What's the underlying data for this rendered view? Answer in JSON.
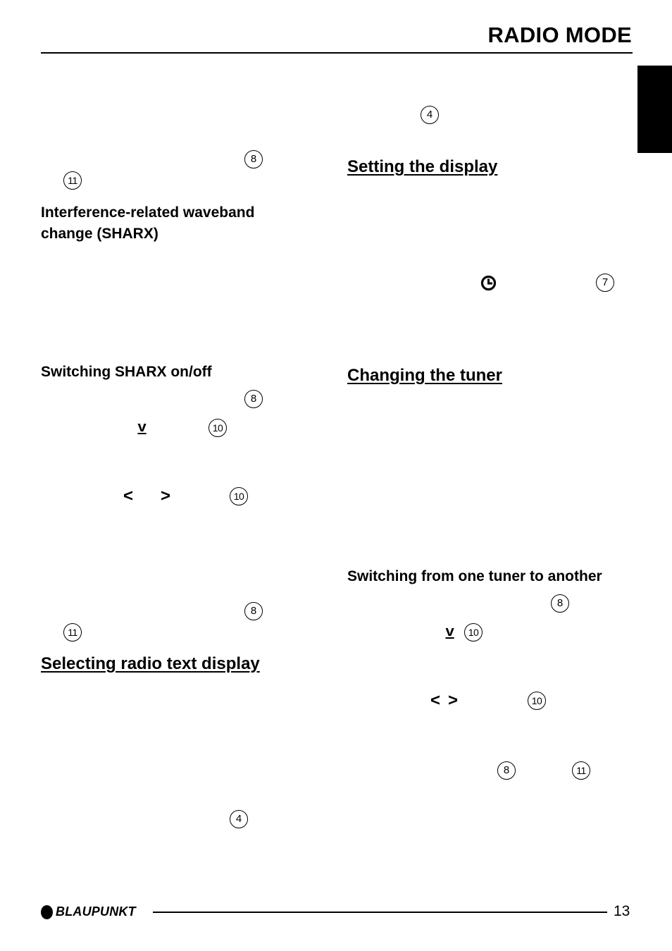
{
  "header": {
    "title": "RADIO MODE"
  },
  "left_column": {
    "refs_top": [
      "8",
      "11"
    ],
    "heading_sharx": "Interference-related waveband change (SHARX)",
    "heading_sharx_line1": "Interference-related waveband",
    "heading_sharx_line2": "change (SHARX)",
    "subheading_switch_sharx": "Switching SHARX on/off",
    "sharx_refs": [
      "8",
      "10",
      "10"
    ],
    "sharx_keys": {
      "down": "v",
      "left": "<",
      "right": ">"
    },
    "refs_bottom": [
      "8",
      "11"
    ],
    "heading_radio_text": "Selecting radio text display",
    "radio_text_ref": "4"
  },
  "right_column": {
    "ref_top": "4",
    "heading_display": "Setting the display",
    "display_ref": "7",
    "display_icon": "clock-icon",
    "heading_tuner": "Changing the tuner",
    "subheading_switch_tuner": "Switching from one tuner to another",
    "tuner_refs": [
      "8",
      "10",
      "10",
      "8",
      "11"
    ],
    "tuner_keys": {
      "down": "v",
      "left": "<",
      "right": ">"
    }
  },
  "footer": {
    "brand": "BLAUPUNKT",
    "page_number": "13"
  }
}
